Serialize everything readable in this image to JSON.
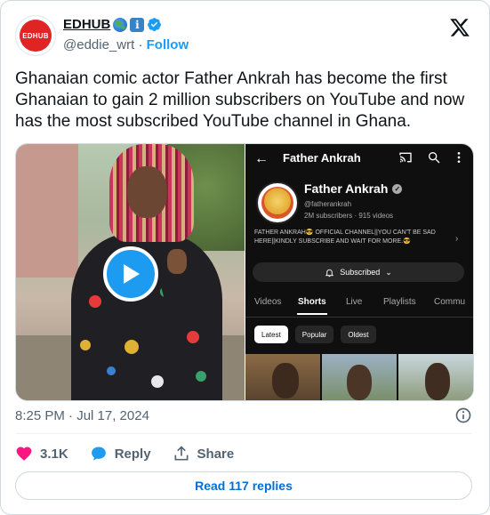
{
  "author": {
    "display_name": "EDHUB",
    "handle": "@eddie_wrt",
    "follow_label": "Follow",
    "avatar_text": "EDHUB"
  },
  "tweet": {
    "text": "Ghanaian comic actor Father Ankrah has become the first Ghanaian to gain 2 million subscribers on YouTube and now has the most subscribed YouTube channel in Ghana.",
    "timestamp": "8:25 PM · Jul 17, 2024"
  },
  "media": {
    "youtube": {
      "back_arrow": "←",
      "title": "Father Ankrah",
      "channel_name": "Father Ankrah",
      "channel_handle": "@fatherankrah",
      "stats": "2M subscribers · 915 videos",
      "description": "FATHER ANKRAH😎 OFFICIAL CHANNEL||YOU CAN'T BE SAD HERE||KINDLY SUBSCRIBE AND WAIT FOR MORE.😎",
      "subscribed_label": "Subscribed",
      "tabs": [
        "Videos",
        "Shorts",
        "Live",
        "Playlists",
        "Commu"
      ],
      "active_tab": "Shorts",
      "chips": [
        "Latest",
        "Popular",
        "Oldest"
      ],
      "active_chip": "Latest"
    }
  },
  "engagement": {
    "likes": "3.1K",
    "reply_label": "Reply",
    "share_label": "Share",
    "read_replies_label": "Read 117 replies"
  },
  "colors": {
    "accent": "#1d9bf0",
    "like": "#f91880",
    "link": "#006fd6"
  }
}
